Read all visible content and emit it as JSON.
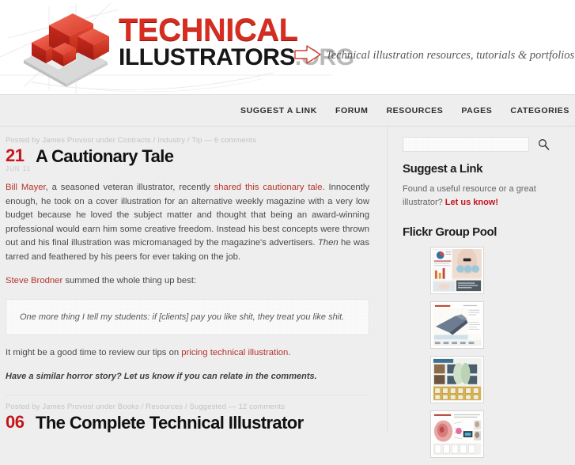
{
  "site": {
    "logo_alt": "ti-isometric-logo",
    "wordmark_line1": "TECHNICAL",
    "wordmark_line2": "ILLUSTRATORS",
    "wordmark_tld": ".ORG",
    "tagline": "Technical illustration resources, tutorials & portfolios"
  },
  "nav": {
    "items": [
      {
        "label": "SUGGEST A LINK"
      },
      {
        "label": "FORUM"
      },
      {
        "label": "RESOURCES"
      },
      {
        "label": "PAGES"
      },
      {
        "label": "CATEGORIES"
      }
    ]
  },
  "posts": [
    {
      "meta": "Posted by James Provost under Contracts / Industry / Tip — 6 comments",
      "day": "21",
      "month": "JUN 11",
      "title": "A Cautionary Tale",
      "para1_link1": "Bill Mayer",
      "para1_a": ", a seasoned veteran illustrator, recently ",
      "para1_link2": "shared this cautionary tale",
      "para1_b": ". Innocently enough, he took on a cover illustration for an alternative weekly magazine with a very low budget because he loved the subject matter and thought that being an award-winning professional would earn him some creative freedom. Instead his best concepts were thrown out and his final illustration was micromanaged by the magazine's advertisers. ",
      "para1_em": "Then",
      "para1_c": " he was tarred and feathered by his peers for ever taking on the job.",
      "para2_link": "Steve Brodner",
      "para2_rest": " summed the whole thing up best:",
      "quote": "One more thing I tell my students: if [clients] pay you like shit, they treat you like shit.",
      "para3_a": "It might be a good time to review our tips on ",
      "para3_link": "pricing technical illustration",
      "para3_b": ".",
      "para4": "Have a similar horror story? Let us know if you can relate in the comments."
    },
    {
      "meta": "Posted by James Provost under Books / Resources / Suggested — 12 comments",
      "day": "06",
      "month": "",
      "title": "The Complete Technical Illustrator"
    }
  ],
  "sidebar": {
    "search": {
      "value": "",
      "placeholder": "",
      "icon": "search-icon"
    },
    "suggest": {
      "title": "Suggest a Link",
      "text_a": "Found a useful resource or a great illustrator? ",
      "link": "Let us know!"
    },
    "flickr": {
      "title": "Flickr Group Pool",
      "thumbs": [
        {
          "name": "flickr-thumb-1"
        },
        {
          "name": "flickr-thumb-2"
        },
        {
          "name": "flickr-thumb-3"
        },
        {
          "name": "flickr-thumb-4"
        }
      ]
    }
  },
  "colors": {
    "brand_red": "#c4161c",
    "link_red": "#b5332c",
    "page_bg": "#eeeeee",
    "header_bg": "#ffffff"
  }
}
